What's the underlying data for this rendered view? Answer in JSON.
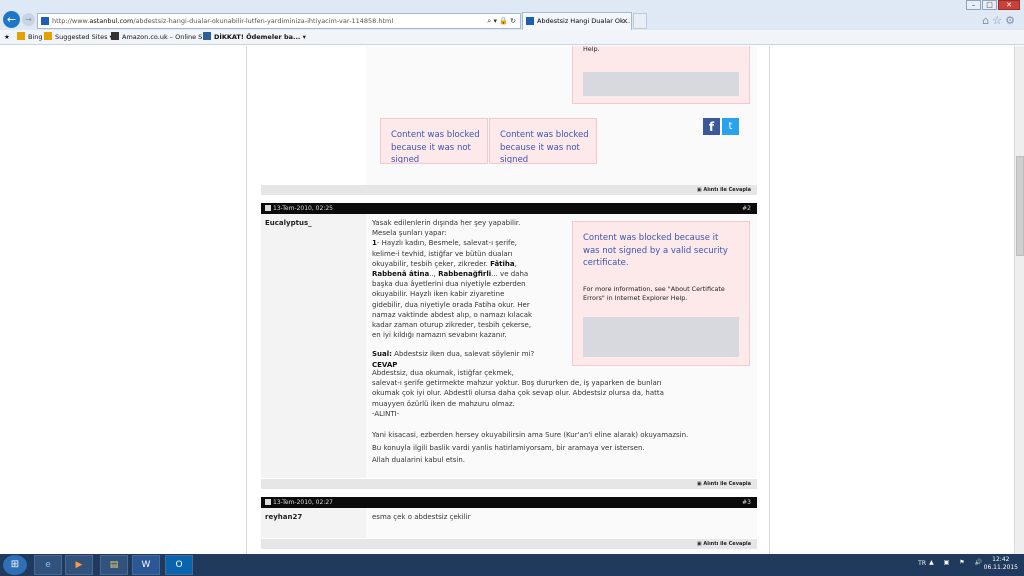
{
  "browser": {
    "url_prefix": "http://www.",
    "url_domain": "astanbul.com",
    "url_rest": "/abdestsiz-hangi-dualar-okunabilir-lutfen-yardiminiza-ihtiyacim-var-114858.html",
    "address_controls": "⌕ ▾ 🔒 ↻",
    "tab_title": "Abdestsiz Hangi Dualar Ok...",
    "tab_close": "×",
    "window_buttons": [
      "–",
      "□",
      "✕"
    ],
    "tool_icons": "⌂☆⚙"
  },
  "favorites": [
    "Bing",
    "Suggested Sites ▾",
    "Amazon.co.uk – Online S...",
    "DİKKAT! Ödemeler ba... ▾"
  ],
  "blocked": {
    "msg_full": "Content was blocked because it was not signed by a valid security certificate.",
    "msg_short": "Content was blocked because it was not signed",
    "more_info": "For more information, see \"About Certificate Errors\" in Internet Explorer Help.",
    "help": "Help."
  },
  "reply_label": "Alıntı ile Cevapla",
  "posts": [
    {
      "date": "13-Tem-2010, 02:25",
      "number": "#2",
      "user": "Eucalyptus_",
      "lines": [
        "Yasak edilenlerin dışında her şey yapabilir.",
        "Mesela şunları yapar:"
      ],
      "item_num": "1",
      "item_text_1": "- Hayzlı kadın, Besmele, salevat-ı şerife,",
      "item_text_2": "kelime-i tevhid, istiğfar ve bütün duaları",
      "item_text_3": "okuyabilir, tesbih çeker, zikreder. ",
      "bold_1": "Fâtiha",
      "bold_2": "Rabbenâ âtina",
      "bold_3": "Rabbenağfirli",
      "rest_lines": [
        "başka dua âyetlerini dua niyetiyle ezberden",
        "okuyabilir. Hayzlı iken kabir ziyaretine",
        "gidebilir, dua niyetiyle orada Fatiha okur. Her",
        "namaz vaktinde abdest alıp, o namazı kılacak",
        "kadar zaman oturup zikreder, tesbih çekerse,",
        "en iyi kıldığı namazın sevabını kazanır."
      ],
      "sual_label": "Sual:",
      "sual_text": " Abdestsiz iken dua, salevat söylenir mi?",
      "cevap_label": "CEVAP",
      "answer_lines": [
        "Abdestsiz, dua okumak, istiğfar çekmek,",
        "salevat-ı şerife getirmekte mahzur yoktur. Boş dururken de, iş yaparken de bunları",
        "okumak çok iyi olur. Abdestli olursa daha çok sevap olur. Abdestsiz olursa da, hatta",
        "muayyen özürlü iken de mahzuru olmaz.",
        "-ALINTI-"
      ],
      "closing_lines": [
        "Yani kisacasi, ezberden hersey okuyabilirsin ama Sure (Kur'an'i eline alarak) okuyamazsin.",
        "Bu konuyla ilgili baslik vardi yanlis hatirlamiyorsam, bir aramaya ver istersen.",
        "Allah dualarini kabul etsin."
      ]
    },
    {
      "date": "13-Tem-2010, 02:27",
      "number": "#3",
      "user": "reyhan27",
      "text": "esma çek o abdestsiz çekilir"
    }
  ],
  "taskbar": {
    "start": "⊞",
    "apps": [
      "e",
      "▶",
      "▤",
      "W",
      "O"
    ],
    "lang": "TR",
    "tray_icons": "▲ ▣ ⚑ 🔊",
    "time": "12:42",
    "date": "06.11.2015"
  }
}
